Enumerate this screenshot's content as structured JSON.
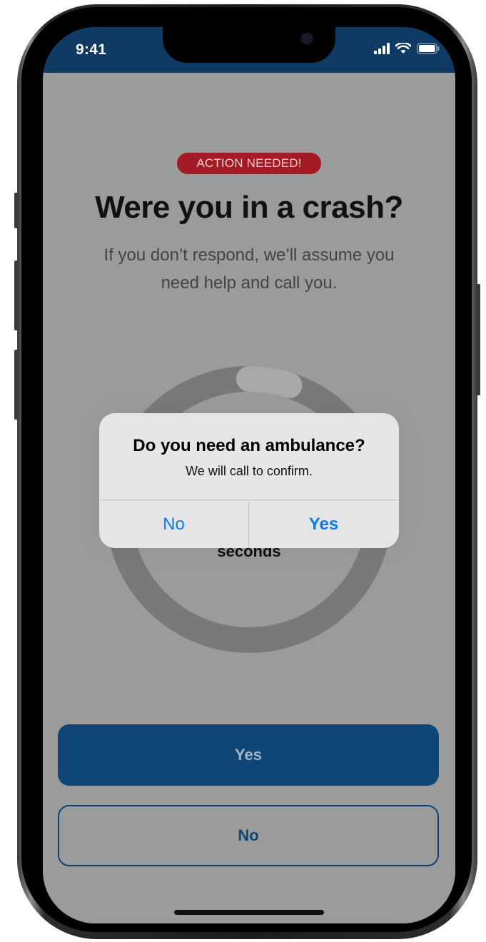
{
  "status_bar": {
    "time": "9:41"
  },
  "screen": {
    "badge": "ACTION NEEDED!",
    "title": "Were you in a crash?",
    "subtitle": "If you don’t respond, we’ll assume you need help and call you.",
    "countdown_unit": "seconds",
    "countdown_progress": 0.05,
    "primary_button": "Yes",
    "secondary_button": "No"
  },
  "alert": {
    "title": "Do you need an ambulance?",
    "message": "We will call to confirm.",
    "no_label": "No",
    "yes_label": "Yes"
  },
  "colors": {
    "header_bg": "#0e3a63",
    "badge_bg": "#a51b25",
    "primary_button": "#0f4676",
    "alert_button_text": "#0a7cf2"
  },
  "icons": [
    "signal-icon",
    "wifi-icon",
    "battery-icon"
  ]
}
